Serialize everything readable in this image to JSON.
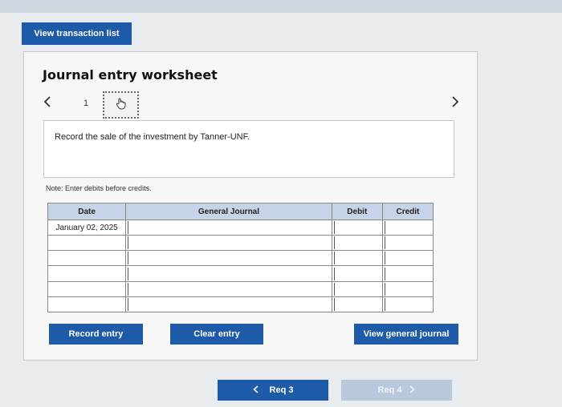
{
  "toolbar": {
    "view_transaction_list": "View transaction list"
  },
  "worksheet": {
    "title": "Journal entry worksheet",
    "nav": {
      "prev_icon": "chevron-left-icon",
      "current": "1",
      "next_icon": "chevron-right-icon"
    },
    "instruction": "Record the sale of the investment by Tanner-UNF.",
    "note": "Note: Enter debits before credits.",
    "table": {
      "headers": [
        "Date",
        "General Journal",
        "Debit",
        "Credit"
      ],
      "rows": [
        {
          "date": "January 02, 2025"
        },
        {
          "date": ""
        },
        {
          "date": ""
        },
        {
          "date": ""
        },
        {
          "date": ""
        },
        {
          "date": ""
        }
      ]
    },
    "buttons": {
      "record": "Record entry",
      "clear": "Clear entry",
      "view_general_journal": "View general journal"
    }
  },
  "pagination": {
    "prev": "Req 3",
    "next": "Req 4"
  },
  "colors": {
    "primary": "#1d5aa8",
    "header": "#c5d4e6",
    "disabled": "#b8c9de"
  }
}
